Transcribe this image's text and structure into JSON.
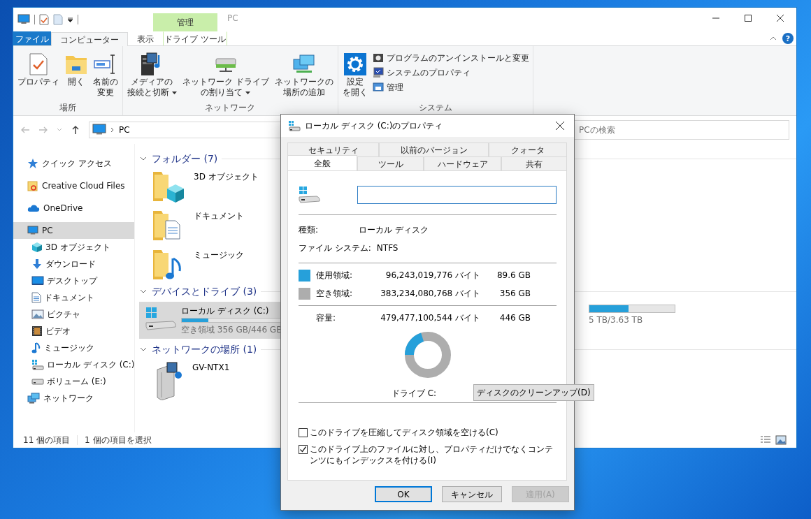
{
  "explorer": {
    "title": "PC",
    "context_group": "管理",
    "ribbon_tabs": [
      {
        "label": "ファイル",
        "kind": "file",
        "selected": false
      },
      {
        "label": "コンピューター",
        "kind": "tab",
        "selected": true
      },
      {
        "label": "表示",
        "kind": "tab",
        "selected": false
      },
      {
        "label": "ドライブ ツール",
        "kind": "context",
        "selected": false
      }
    ],
    "ribbon_groups": [
      {
        "label": "場所",
        "items": [
          {
            "kind": "large",
            "lines": [
              "プロパティ"
            ],
            "dropdown": false
          },
          {
            "kind": "large",
            "lines": [
              "開く"
            ],
            "dropdown": false
          },
          {
            "kind": "large",
            "lines": [
              "名前の",
              "変更"
            ],
            "dropdown": false
          }
        ]
      },
      {
        "label": "ネットワーク",
        "items": [
          {
            "kind": "large",
            "lines": [
              "メディアの",
              "接続と切断"
            ],
            "dropdown": true
          },
          {
            "kind": "large",
            "lines": [
              "ネットワーク ドライブ",
              "の割り当て"
            ],
            "dropdown": true
          },
          {
            "kind": "large",
            "lines": [
              "ネットワークの",
              "場所の追加"
            ],
            "dropdown": false
          }
        ]
      },
      {
        "label": "システム",
        "items": [
          {
            "kind": "large",
            "lines": [
              "設定",
              "を開く"
            ],
            "dropdown": false
          },
          {
            "kind": "small",
            "lines": [
              "プログラムのアンインストールと変更"
            ],
            "dropdown": false
          },
          {
            "kind": "small",
            "lines": [
              "システムのプロパティ"
            ],
            "dropdown": false
          },
          {
            "kind": "small",
            "lines": [
              "管理"
            ],
            "dropdown": false
          }
        ]
      }
    ],
    "help": "?",
    "address": "PC",
    "search_placeholder": "PCの検索",
    "sidebar": [
      {
        "label": "クイック アクセス",
        "selected": false
      },
      {
        "label": "Creative Cloud Files",
        "selected": false
      },
      {
        "label": "OneDrive",
        "selected": false
      },
      {
        "label": "PC",
        "selected": true,
        "children": [
          {
            "label": "3D オブジェクト",
            "selected": false
          },
          {
            "label": "ダウンロード",
            "selected": false
          },
          {
            "label": "デスクトップ",
            "selected": false
          },
          {
            "label": "ドキュメント",
            "selected": false
          },
          {
            "label": "ピクチャ",
            "selected": false
          },
          {
            "label": "ビデオ",
            "selected": false
          },
          {
            "label": "ミュージック",
            "selected": false
          },
          {
            "label": "ローカル ディスク (C:)",
            "selected": false
          },
          {
            "label": "ボリューム (E:)",
            "selected": false
          }
        ]
      },
      {
        "label": "ネットワーク",
        "selected": false
      }
    ],
    "sections": [
      {
        "title": "フォルダー (7)",
        "expanded": true,
        "items": [
          {
            "kind": "folder",
            "name": "3D オブジェクト"
          },
          {
            "kind": "folder",
            "name": "ドキュメント"
          },
          {
            "kind": "folder",
            "name": "ミュージック"
          }
        ]
      },
      {
        "title": "デバイスとドライブ (3)",
        "expanded": true,
        "items": [
          {
            "kind": "drive",
            "name": "ローカル ディスク (C:)",
            "level": 0.2,
            "detail": "空き領域 356 GB/446 GB",
            "selected": true
          },
          {
            "kind": "drive",
            "level": 0.46,
            "detail": "5 TB/3.63 TB",
            "selected": false
          }
        ]
      },
      {
        "title": "ネットワークの場所 (1)",
        "expanded": true,
        "items": [
          {
            "kind": "network",
            "name": "GV-NTX1"
          }
        ]
      }
    ],
    "status": [
      "11 個の項目",
      "1 個の項目を選択"
    ]
  },
  "dialog": {
    "title": "ローカル ディスク (C:)のプロパティ",
    "tab_rows": [
      [
        {
          "label": "セキュリティ",
          "selected": false
        },
        {
          "label": "以前のバージョン",
          "selected": false
        },
        {
          "label": "クォータ",
          "selected": false
        }
      ],
      [
        {
          "label": "全般",
          "selected": true
        },
        {
          "label": "ツール",
          "selected": false
        },
        {
          "label": "ハードウェア",
          "selected": false
        },
        {
          "label": "共有",
          "selected": false
        }
      ]
    ],
    "fields": [
      {
        "label": "種類:",
        "value": "ローカル ディスク"
      },
      {
        "label": "ファイル システム:",
        "value": "NTFS"
      }
    ],
    "usage": [
      {
        "label": "使用領域:",
        "bytes": "96,243,019,776 バイト",
        "size": "89.6 GB",
        "color": "#26a0da"
      },
      {
        "label": "空き領域:",
        "bytes": "383,234,080,768 バイト",
        "size": "356 GB",
        "color": "#adadad"
      }
    ],
    "capacity": {
      "label": "容量:",
      "bytes": "479,477,100,544 バイト",
      "size": "446 GB"
    },
    "meter": {
      "level": 0.2
    },
    "drive_label": "ドライブ C:",
    "cleanup_button": "ディスクのクリーンアップ(D)",
    "options": [
      {
        "label": "このドライブを圧縮してディスク領域を空ける(C)",
        "checked": false
      },
      {
        "label": "このドライブ上のファイルに対し、プロパティだけでなくコンテンツにもインデックスを付ける(I)",
        "checked": true
      }
    ],
    "buttons": [
      {
        "label": "OK",
        "kind": "default",
        "disabled": false
      },
      {
        "label": "キャンセル",
        "kind": "normal",
        "disabled": false
      },
      {
        "label": "適用(A)",
        "kind": "normal",
        "disabled": true
      }
    ]
  }
}
